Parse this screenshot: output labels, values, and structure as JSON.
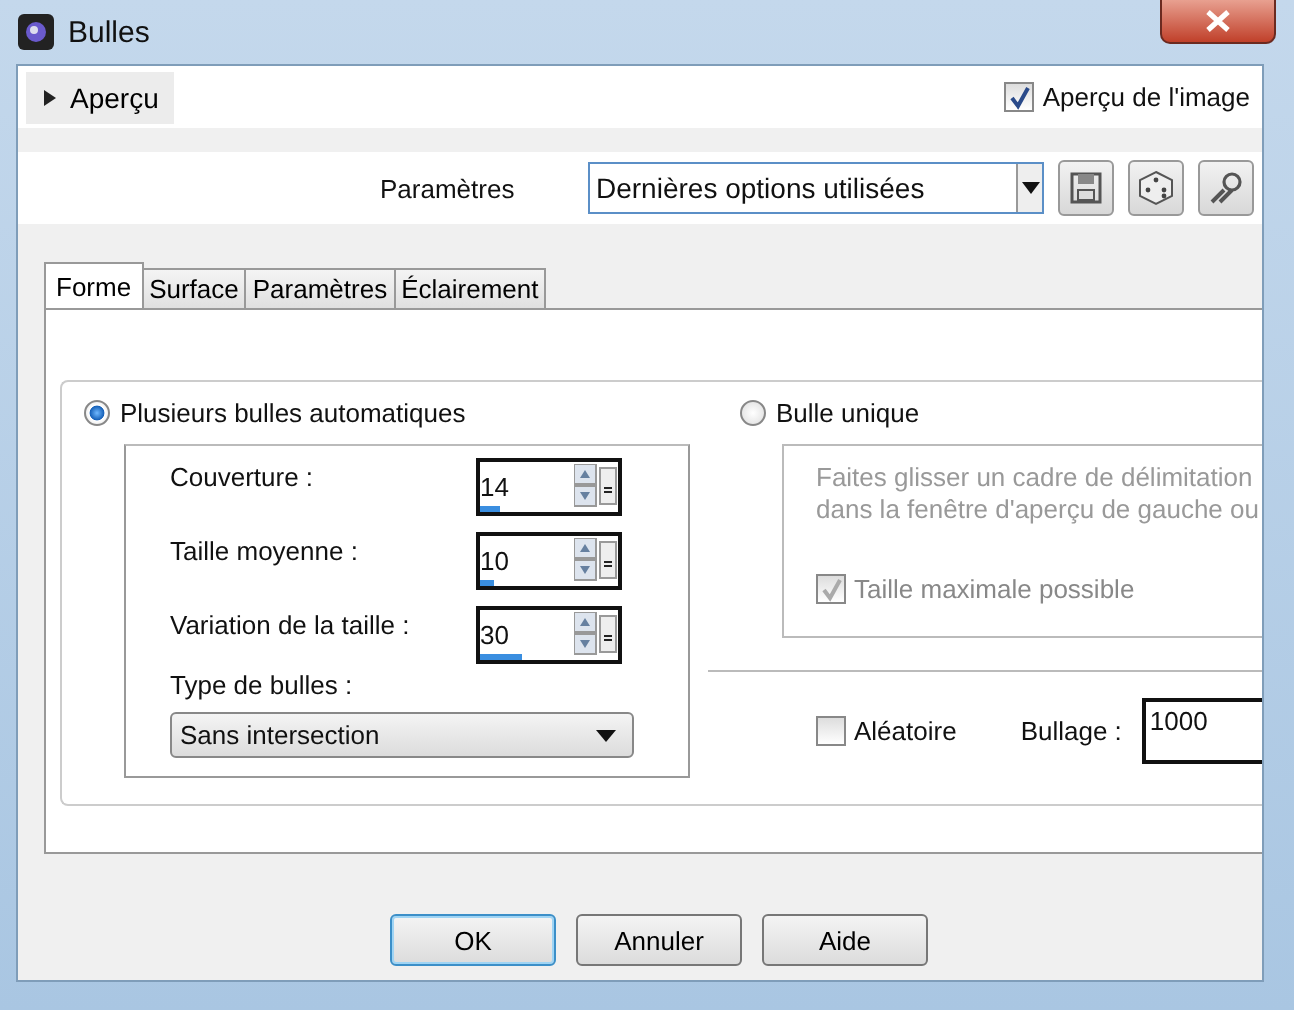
{
  "window": {
    "title": "Bulles"
  },
  "preview": {
    "label": "Aperçu",
    "expanded": false
  },
  "image_preview": {
    "label": "Aperçu de l'image",
    "checked": true
  },
  "presets": {
    "label": "Paramètres",
    "value": "Dernières options utilisées"
  },
  "tabs": [
    {
      "label": "Forme",
      "selected": true
    },
    {
      "label": "Surface",
      "selected": false
    },
    {
      "label": "Paramètres",
      "selected": false
    },
    {
      "label": "Éclairement",
      "selected": false
    }
  ],
  "modes": [
    {
      "label": "Plusieurs bulles automatiques",
      "selected": true
    },
    {
      "label": "Bulle unique",
      "selected": false
    }
  ],
  "auto_fields": [
    {
      "label": "Couverture :",
      "value": "14",
      "level": 0.14
    },
    {
      "label": "Taille moyenne :",
      "value": "10",
      "level": 0.1
    },
    {
      "label": "Variation de la taille :",
      "value": "30",
      "level": 0.3
    }
  ],
  "bubble_type": {
    "label": "Type de bulles :",
    "value": "Sans intersection"
  },
  "single": {
    "hint_lines": [
      "Faites glisser un cadre de délimitation",
      "dans la fenêtre d'aperçu de gauche ou"
    ],
    "max_size": {
      "label": "Taille maximale possible",
      "checked": true,
      "disabled": true
    }
  },
  "random": {
    "label": "Aléatoire",
    "checked": false
  },
  "bubbling": {
    "label": "Bullage :",
    "value": "1000"
  },
  "buttons": [
    {
      "label": "OK",
      "default": true
    },
    {
      "label": "Annuler",
      "default": false
    },
    {
      "label": "Aide",
      "default": false
    }
  ]
}
